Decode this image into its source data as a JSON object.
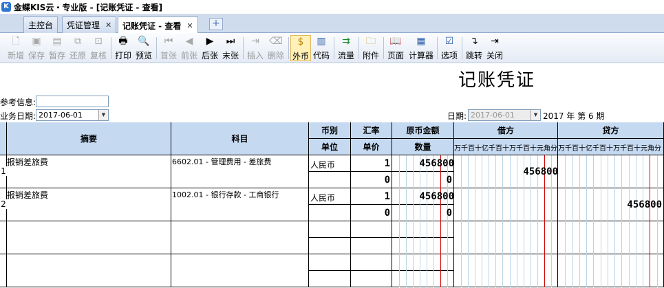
{
  "window": {
    "title": "金蝶KIS云・专业版 - [记账凭证 - 查看]",
    "logo": "K"
  },
  "tabs": [
    {
      "label": "主控台",
      "closable": false
    },
    {
      "label": "凭证管理",
      "closable": true
    },
    {
      "label": "记账凭证 - 查看",
      "closable": true,
      "active": true
    }
  ],
  "tab_add": "+",
  "toolbar": {
    "buttons": [
      {
        "label": "新增",
        "icon": "new-icon",
        "glyph": "🗋",
        "enabled": false
      },
      {
        "label": "保存",
        "icon": "save-icon",
        "glyph": "▣",
        "enabled": false
      },
      {
        "label": "暂存",
        "icon": "temp-save-icon",
        "glyph": "▤",
        "enabled": false
      },
      {
        "label": "还原",
        "icon": "restore-icon",
        "glyph": "⧉",
        "enabled": false
      },
      {
        "label": "复核",
        "icon": "review-icon",
        "glyph": "⊡",
        "enabled": false
      },
      {
        "label": "打印",
        "icon": "print-icon",
        "glyph": "🖶",
        "enabled": true
      },
      {
        "label": "预览",
        "icon": "preview-icon",
        "glyph": "🔍",
        "enabled": true
      },
      {
        "label": "首张",
        "icon": "first-icon",
        "glyph": "⏮",
        "enabled": false
      },
      {
        "label": "前张",
        "icon": "prev-icon",
        "glyph": "◀",
        "enabled": false
      },
      {
        "label": "后张",
        "icon": "next-icon",
        "glyph": "▶",
        "enabled": true
      },
      {
        "label": "末张",
        "icon": "last-icon",
        "glyph": "⏭",
        "enabled": true
      },
      {
        "label": "插入",
        "icon": "insert-icon",
        "glyph": "⇥",
        "enabled": false
      },
      {
        "label": "删除",
        "icon": "delete-icon",
        "glyph": "⌫",
        "enabled": false
      },
      {
        "label": "外币",
        "icon": "currency-icon",
        "glyph": "$",
        "enabled": true,
        "selected": true
      },
      {
        "label": "代码",
        "icon": "code-icon",
        "glyph": "▥",
        "enabled": true
      },
      {
        "label": "流量",
        "icon": "flow-icon",
        "glyph": "⇉",
        "enabled": true
      },
      {
        "label": "附件",
        "icon": "folder-icon",
        "glyph": "🗀",
        "enabled": true
      },
      {
        "label": "页面",
        "icon": "page-icon",
        "glyph": "📖",
        "enabled": true
      },
      {
        "label": "计算器",
        "icon": "calculator-icon",
        "glyph": "▦",
        "enabled": true
      },
      {
        "label": "选项",
        "icon": "options-icon",
        "glyph": "☑",
        "enabled": true
      },
      {
        "label": "跳转",
        "icon": "jump-icon",
        "glyph": "↴",
        "enabled": true
      },
      {
        "label": "关闭",
        "icon": "exit-icon",
        "glyph": "⇥",
        "enabled": true
      }
    ]
  },
  "voucher": {
    "title": "记账凭证",
    "ref_label": "参考信息:",
    "ref_value": "",
    "biz_date_label": "业务日期:",
    "biz_date": "2017-06-01",
    "date_label": "日期:",
    "date": "2017-06-01",
    "period_text": "2017 年 第 6 期"
  },
  "grid": {
    "headers": {
      "summary": "摘要",
      "account": "科目",
      "currency": "币别",
      "unit": "单位",
      "rate": "汇率",
      "unit_price": "单价",
      "orig_amount": "原币金额",
      "quantity": "数量",
      "debit": "借方",
      "credit": "贷方",
      "digit_labels": "万千百十亿千百十万千百十元角分"
    },
    "rows": [
      {
        "no": "1",
        "summary": "报销差旅费",
        "account": "6602.01 - 管理费用 - 差旅费",
        "currency": "人民币",
        "rate": "1",
        "orig_amount": "456800",
        "unit_price": "0",
        "quantity": "0",
        "debit": "456800",
        "credit": ""
      },
      {
        "no": "2",
        "summary": "报销差旅费",
        "account": "1002.01 - 银行存款 - 工商银行",
        "currency": "人民币",
        "rate": "1",
        "orig_amount": "456800",
        "unit_price": "0",
        "quantity": "0",
        "debit": "",
        "credit": "456800"
      }
    ]
  }
}
